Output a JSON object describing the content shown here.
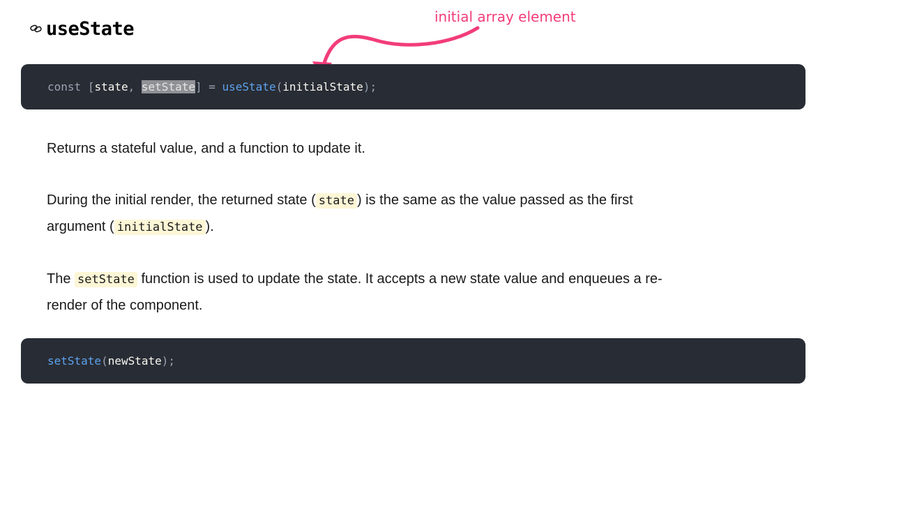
{
  "heading": {
    "title": "useState",
    "icon": "link-icon"
  },
  "annotation": {
    "text": "initial array element",
    "color": "#f23d7a"
  },
  "code_block_1": {
    "background": "#282c34",
    "tokens": {
      "keyword": "const",
      "space1": " ",
      "open_bracket": "[",
      "state": "state",
      "comma": ",",
      "space2": " ",
      "set_state": "setState",
      "close_bracket": "]",
      "assign": " = ",
      "use_state": "useState",
      "open_paren": "(",
      "initial_state": "initialState",
      "close_paren": ");"
    }
  },
  "paragraph_1": {
    "text": "Returns a stateful value, and a function to update it."
  },
  "paragraph_2": {
    "text1": "During the initial render, the returned state (",
    "code1": "state",
    "text2": ") is the same as the value passed as the first argument (",
    "code2": "initialState",
    "text3": ")."
  },
  "paragraph_3": {
    "text1": "The ",
    "code1": "setState",
    "text2": " function is used to update the state. It accepts a new state value and enqueues a re-render of the component."
  },
  "code_block_2": {
    "background": "#282c34",
    "tokens": {
      "func": "setState",
      "open_paren": "(",
      "arg": "newState",
      "close_paren": ");"
    }
  }
}
